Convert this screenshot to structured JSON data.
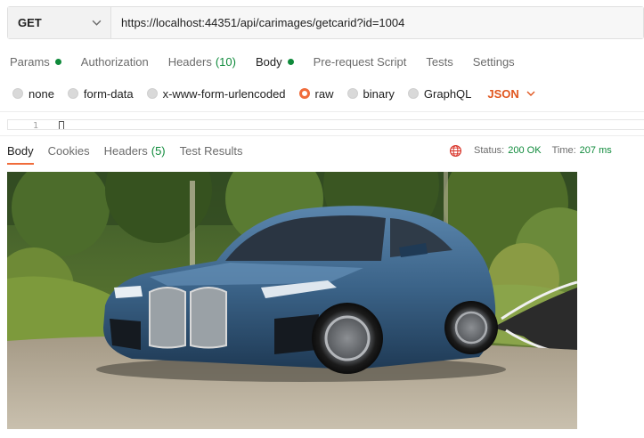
{
  "request": {
    "method": "GET",
    "url": "https://localhost:44351/api/carimages/getcarid?id=1004"
  },
  "request_tabs": [
    {
      "label": "Params",
      "count": "",
      "dot": true
    },
    {
      "label": "Authorization",
      "count": "",
      "dot": false
    },
    {
      "label": "Headers",
      "count": "(10)",
      "dot": false
    },
    {
      "label": "Body",
      "count": "",
      "dot": true,
      "active": true
    },
    {
      "label": "Pre-request Script",
      "count": "",
      "dot": false
    },
    {
      "label": "Tests",
      "count": "",
      "dot": false
    },
    {
      "label": "Settings",
      "count": "",
      "dot": false
    }
  ],
  "body_types": {
    "options": [
      "none",
      "form-data",
      "x-www-form-urlencoded",
      "raw",
      "binary",
      "GraphQL"
    ],
    "selected": "raw",
    "format": "JSON"
  },
  "editor": {
    "line_number": "1"
  },
  "response_tabs": [
    {
      "label": "Body",
      "count": "",
      "active": true
    },
    {
      "label": "Cookies",
      "count": ""
    },
    {
      "label": "Headers",
      "count": "(5)"
    },
    {
      "label": "Test Results",
      "count": ""
    }
  ],
  "response_status": {
    "status_label": "Status:",
    "status_value": "200 OK",
    "time_label": "Time:",
    "time_value": "207 ms"
  },
  "response_preview": {
    "icon": "car-photo"
  },
  "colors": {
    "accent": "#f06c3b",
    "success": "#0f8a3b",
    "json_format": "#e0561e"
  }
}
